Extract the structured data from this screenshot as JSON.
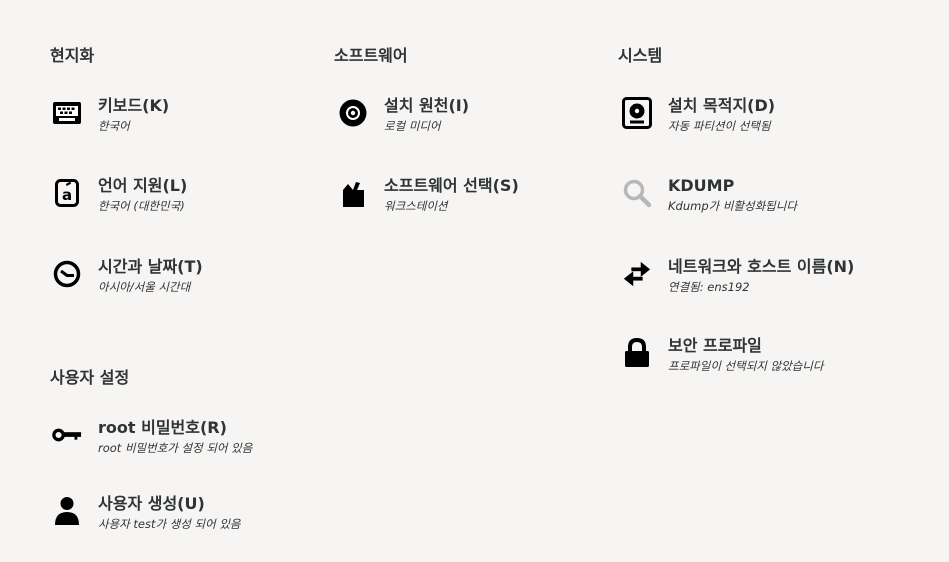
{
  "sections": {
    "localization": {
      "title": "현지화",
      "keyboard": {
        "label": "키보드(K)",
        "status": "한국어",
        "icon": "keyboard-icon"
      },
      "language": {
        "label": "언어 지원(L)",
        "status": "한국어 (대한민국)",
        "icon": "language-icon"
      },
      "time": {
        "label": "시간과 날짜(T)",
        "status": "아시아/서울 시간대",
        "icon": "clock-icon"
      }
    },
    "software": {
      "title": "소프트웨어",
      "source": {
        "label": "설치 원천(I)",
        "status": "로컬 미디어",
        "icon": "disc-icon"
      },
      "selection": {
        "label": "소프트웨어 선택(S)",
        "status": "워크스테이션",
        "icon": "package-icon"
      }
    },
    "system": {
      "title": "시스템",
      "destination": {
        "label": "설치 목적지(D)",
        "status": "자동 파티션이 선택됨",
        "icon": "harddisk-icon"
      },
      "kdump": {
        "label": "KDUMP",
        "status": "Kdump가 비활성화됩니다",
        "icon": "search-icon"
      },
      "network": {
        "label": "네트워크와 호스트 이름(N)",
        "status": "연결됨: ens192",
        "icon": "network-arrows-icon"
      },
      "security": {
        "label": "보안 프로파일",
        "status": "프로파일이 선택되지 않았습니다",
        "icon": "lock-icon"
      }
    },
    "user": {
      "title": "사용자 설정",
      "root": {
        "label": "root 비밀번호(R)",
        "status": "root 비밀번호가 설정 되어 있음",
        "icon": "key-icon"
      },
      "create_user": {
        "label": "사용자 생성(U)",
        "status": "사용자 test가 생성 되어 있음",
        "icon": "user-icon"
      }
    }
  },
  "colors": {
    "background": "#f6f5f4",
    "icon": "#000000",
    "icon_disabled": "#b8b8b8",
    "text": "#2e3436"
  }
}
